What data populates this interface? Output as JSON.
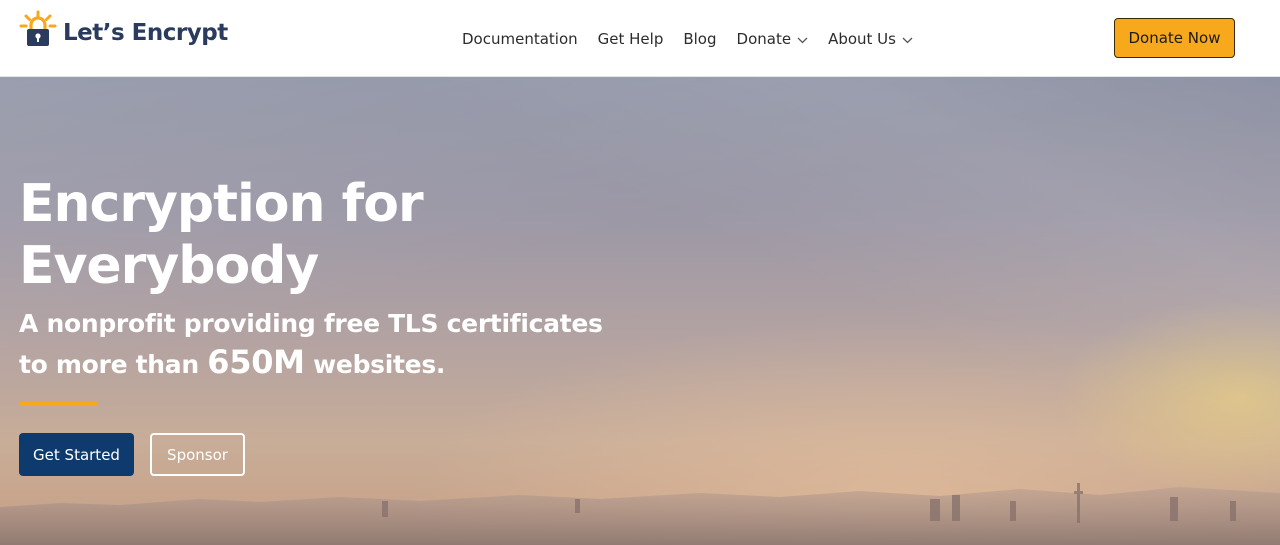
{
  "header": {
    "logo_text": "Let’s Encrypt",
    "nav": [
      {
        "label": "Documentation",
        "has_menu": false
      },
      {
        "label": "Get Help",
        "has_menu": false
      },
      {
        "label": "Blog",
        "has_menu": false
      },
      {
        "label": "Donate",
        "has_menu": true
      },
      {
        "label": "About Us",
        "has_menu": true
      }
    ],
    "cta_label": "Donate Now"
  },
  "hero": {
    "title_line1": "Encryption for",
    "title_line2": "Everybody",
    "subtitle_line1": "A nonprofit providing free TLS certificates",
    "subtitle_pre": "to more than ",
    "subtitle_number": "650M",
    "subtitle_post": " websites.",
    "primary_button": "Get Started",
    "secondary_button": "Sponsor"
  },
  "colors": {
    "brand_navy": "#0e3a6d",
    "accent_orange": "#f7a81b",
    "logo_text": "#2a3b5e"
  },
  "icons": {
    "logo": "padlock-sun-icon",
    "dropdown": "chevron-down-icon"
  }
}
